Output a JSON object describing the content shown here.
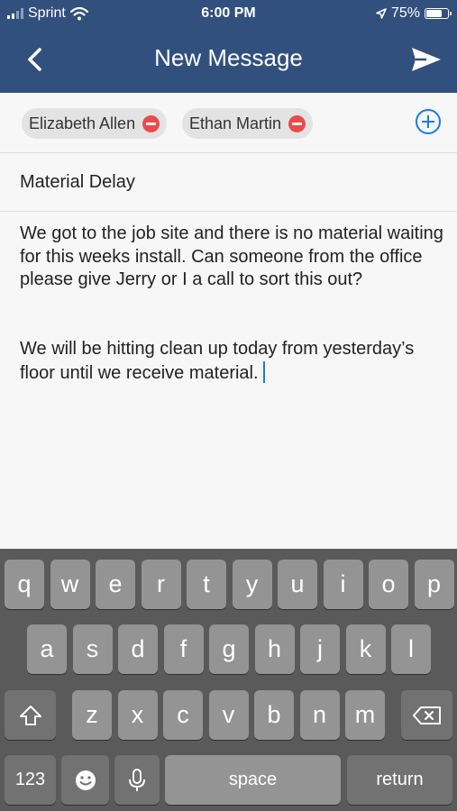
{
  "status_bar": {
    "carrier": "Sprint",
    "time": "6:00 PM",
    "battery": "75%",
    "battery_level": 0.75
  },
  "header": {
    "title": "New Message",
    "back_icon": "chevron-left-icon",
    "send_icon": "paper-plane-icon"
  },
  "recipients": [
    {
      "name": "Elizabeth Allen",
      "remove_icon": "minus-circle-icon"
    },
    {
      "name": "Ethan Martin",
      "remove_icon": "minus-circle-icon"
    }
  ],
  "add_recipient_icon": "plus-circle-icon",
  "subject": "Material Delay",
  "body": {
    "paragraph1": "We got to the job site and there is no material waiting for this weeks install. Can someone from the office please give Jerry or I a call to sort this out?",
    "paragraph2": "We will be hitting clean up today from yesterday’s floor until we receive material."
  },
  "keyboard": {
    "row1": [
      "q",
      "w",
      "e",
      "r",
      "t",
      "y",
      "u",
      "i",
      "o",
      "p"
    ],
    "row2": [
      "a",
      "s",
      "d",
      "f",
      "g",
      "h",
      "j",
      "k",
      "l"
    ],
    "row3": [
      "z",
      "x",
      "c",
      "v",
      "b",
      "n",
      "m"
    ],
    "numbers_key": "123",
    "space_key": "space",
    "return_key": "return",
    "shift_icon": "shift-icon",
    "delete_icon": "backspace-icon",
    "emoji_icon": "emoji-icon",
    "mic_icon": "microphone-icon"
  },
  "colors": {
    "header_bg": "#31507d",
    "accent": "#1a7be6",
    "remove": "#e94b4b"
  }
}
